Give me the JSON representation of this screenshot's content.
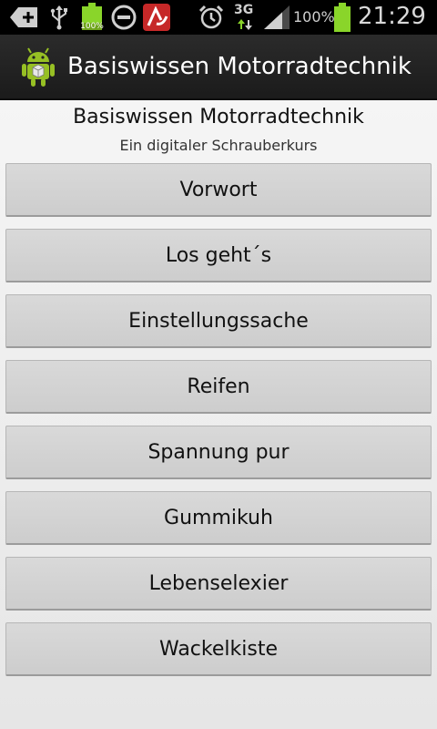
{
  "status_bar": {
    "battery_small_label": "100%",
    "network_label": "3G",
    "battery_percent": "100%",
    "time": "21:29"
  },
  "action_bar": {
    "title": "Basiswissen Motorradtechnik"
  },
  "main": {
    "heading": "Basiswissen Motorradtechnik",
    "subheading": "Ein digitaler Schrauberkurs",
    "menu": [
      {
        "label": "Vorwort"
      },
      {
        "label": "Los geht´s"
      },
      {
        "label": "Einstellungssache"
      },
      {
        "label": "Reifen"
      },
      {
        "label": "Spannung pur"
      },
      {
        "label": "Gummikuh"
      },
      {
        "label": "Lebenselexier"
      },
      {
        "label": "Wackelkiste"
      }
    ]
  },
  "colors": {
    "status_bar_bg": "#000000",
    "action_bar_bg": "#222222",
    "battery_green": "#8ad52a",
    "button_bg": "#d4d4d4",
    "android_green": "#97c024"
  }
}
